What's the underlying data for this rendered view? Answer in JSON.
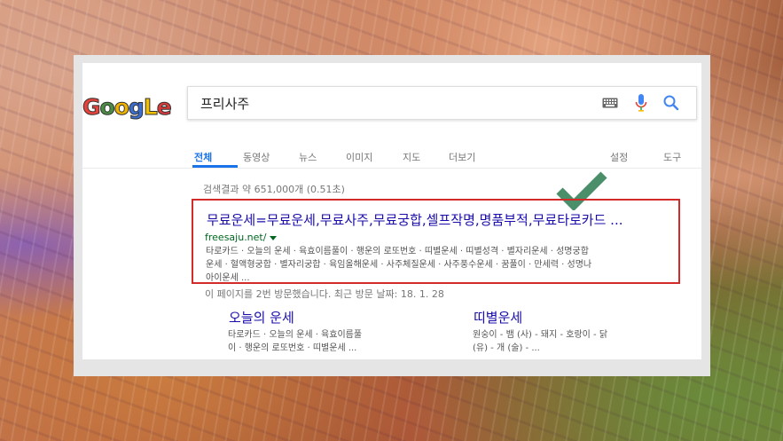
{
  "logo": {
    "letters": [
      "G",
      "o",
      "o",
      "g",
      "L",
      "e"
    ],
    "colors": [
      "#e8433a",
      "#4a8e44",
      "#f0b400",
      "#3a6fd1",
      "#f0c000",
      "#d93a3a"
    ]
  },
  "search": {
    "query": "프리사주"
  },
  "tabs": [
    {
      "label": "전체",
      "active": true
    },
    {
      "label": "동영상"
    },
    {
      "label": "뉴스"
    },
    {
      "label": "이미지"
    },
    {
      "label": "지도"
    },
    {
      "label": "더보기"
    },
    {
      "label": "설정"
    },
    {
      "label": "도구"
    }
  ],
  "stats": "검색결과 약 651,000개 (0.51초)",
  "result": {
    "title": "무료운세=무료운세,무료사주,무료궁합,셀프작명,명품부적,무료타로카드 ...",
    "url": "freesaju.net/",
    "snippet": [
      "타로카드 · 오늘의 운세 · 육효이름풀이 · 행운의 로또번호 · 띠별운세 · 띠별성격 · 별자리운세 · 성명궁합",
      "운세 · 혈액형궁합 · 별자리궁합 · 육임올해운세 · 사주체질운세 · 사주풍수운세 · 꿈풀이 · 만세력 · 성명나",
      "아이운세 ..."
    ]
  },
  "visited": "이 페이지를 2번 방문했습니다. 최근 방문 날짜: 18. 1. 28",
  "sitelinks": [
    {
      "title": "오늘의 운세",
      "desc": [
        "타로카드 · 오늘의 운세 · 육효이름풀",
        "이 · 행운의 로또번호 · 띠별운세 ..."
      ]
    },
    {
      "title": "띠별운세",
      "desc": [
        "원숭이 - 뱀 (사) - 돼지 - 호랑이 - 닭",
        "(유) - 개 (술) - ..."
      ]
    }
  ],
  "accent": "#1a73e8",
  "highlight_color": "#d32a2a",
  "check_color": "#4a8e6a"
}
